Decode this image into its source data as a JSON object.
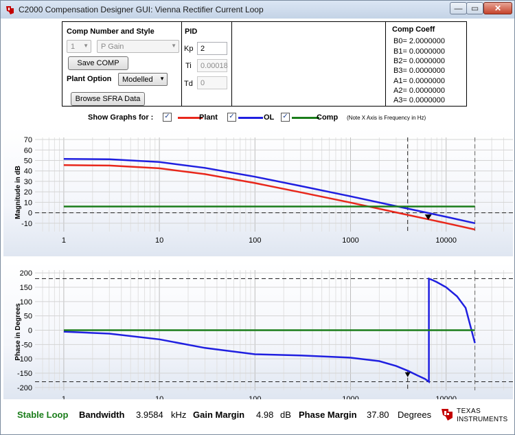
{
  "window": {
    "title": "C2000 Compensation Designer GUI: Vienna Rectifier Current Loop",
    "min_glyph": "—",
    "max_glyph": "▭",
    "close_glyph": "✕"
  },
  "comp": {
    "title": "Comp Number and Style",
    "number_value": "1",
    "style_value": "P Gain",
    "save_label": "Save COMP",
    "plant_label": "Plant Option",
    "plant_value": "Modelled",
    "browse_label": "Browse SFRA Data"
  },
  "pid": {
    "title": "PID",
    "kp_label": "Kp",
    "kp_value": "2",
    "ti_label": "Ti",
    "ti_value": "0.00018",
    "td_label": "Td",
    "td_value": "0"
  },
  "coeff": {
    "title": "Comp Coeff",
    "lines": [
      "B0= 2.0000000",
      "B1= 0.0000000",
      "B2= 0.0000000",
      "B3= 0.0000000",
      "A1= 0.0000000",
      "A2= 0.0000000",
      "A3= 0.0000000"
    ]
  },
  "show": {
    "label": "Show Graphs for :",
    "check": "✓",
    "plant": "Plant",
    "ol": "OL",
    "comp": "Comp",
    "note": "(Note X Axis is Frequency in Hz)"
  },
  "colors": {
    "plant": "#e8271b",
    "ol": "#1f1fe0",
    "comp": "#1a7d1a",
    "stable": "#1a7d1a",
    "ti_red": "#cc0000"
  },
  "chart_data": [
    {
      "type": "line",
      "ylabel": "Magnitude in dB",
      "x_scale": "log",
      "xlim": [
        0.5,
        50000
      ],
      "ylim": [
        -18,
        72
      ],
      "x_ticks": [
        1,
        10,
        100,
        1000,
        10000
      ],
      "y_ticks": [
        70,
        60,
        50,
        40,
        30,
        20,
        10,
        0,
        -10
      ],
      "grid": true,
      "series": [
        {
          "name": "Plant",
          "x": [
            1,
            3,
            10,
            30,
            100,
            300,
            1000,
            3000,
            10000,
            20000
          ],
          "y": [
            45.5,
            45.1,
            42.5,
            36.9,
            28.4,
            19.6,
            9.7,
            0.3,
            -9.9,
            -16
          ]
        },
        {
          "name": "OL",
          "x": [
            1,
            3,
            10,
            30,
            100,
            300,
            1000,
            3000,
            10000,
            20000
          ],
          "y": [
            51.5,
            51.1,
            48.5,
            42.9,
            34.4,
            25.6,
            15.7,
            6.3,
            -3.9,
            -10
          ]
        },
        {
          "name": "Comp",
          "x": [
            1,
            20000
          ],
          "y": [
            6,
            6
          ]
        }
      ],
      "markers": {
        "bandwidth_x": 3958.4,
        "zero_line_y": 0,
        "end_x": 20000,
        "gain_margin_x": 6500,
        "gain_margin_y": -4.98
      }
    },
    {
      "type": "line",
      "ylabel": "Phase in Degrees",
      "x_scale": "log",
      "xlim": [
        0.5,
        50000
      ],
      "ylim": [
        -210,
        210
      ],
      "x_ticks": [
        1,
        10,
        100,
        1000,
        10000
      ],
      "y_ticks": [
        200,
        150,
        100,
        50,
        0,
        -50,
        -100,
        -150,
        -200
      ],
      "grid": true,
      "series": [
        {
          "name": "OL",
          "x": [
            1,
            3,
            10,
            30,
            100,
            300,
            1000,
            2000,
            3000,
            4000,
            5000,
            6000,
            6600,
            6600,
            7000,
            8000,
            10000,
            13000,
            16000,
            20000
          ],
          "y": [
            -5,
            -12,
            -32,
            -62,
            -84,
            -88,
            -96,
            -108,
            -125,
            -142,
            -158,
            -170,
            -180,
            180,
            177,
            168,
            150,
            118,
            78,
            -45
          ]
        },
        {
          "name": "Comp",
          "x": [
            1,
            20000
          ],
          "y": [
            0,
            0
          ]
        }
      ],
      "markers": {
        "bandwidth_x": 3958.4,
        "ref_lines_y": [
          180,
          -180
        ],
        "end_x": 20000,
        "phase_margin_y": -142.2
      }
    }
  ],
  "status": {
    "stable": "Stable Loop",
    "bw_label": "Bandwidth",
    "bw_value": "3.9584",
    "bw_unit": "kHz",
    "gm_label": "Gain Margin",
    "gm_value": "4.98",
    "gm_unit": "dB",
    "pm_label": "Phase Margin",
    "pm_value": "37.80",
    "pm_unit": "Degrees"
  },
  "logo": {
    "line1": "TEXAS",
    "line2": "INSTRUMENTS"
  }
}
